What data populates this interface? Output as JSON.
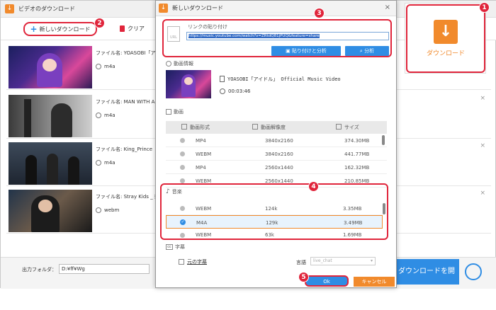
{
  "main": {
    "title": "ビデオのダウンロード",
    "new_download": "新しいダウンロード",
    "clear": "クリア",
    "items": [
      {
        "name": "ファイル名: YOASOBI「アイドル」",
        "format": "m4a"
      },
      {
        "name": "ファイル名: MAN WITH A M",
        "format": "m4a"
      },
      {
        "name": "ファイル名: King_Prince「なに",
        "format": "m4a"
      },
      {
        "name": "ファイル名: Stray Kids _ 樂(S",
        "format": "webm"
      }
    ],
    "output_label": "出力フォルダ：",
    "output_path": "D:¥ff¥Wg",
    "download_start": "ダウンロードを開始",
    "big_download": "ダウンロード"
  },
  "dialog": {
    "title": "新しいダウンロード",
    "close": "×",
    "paste_label": "リンクの貼り付け",
    "url": "https://music.youtube.com/watch?v=ZRtdQ81jPUQ&feature=share",
    "paste_analyze": "貼り付けと分析",
    "analyze": "分析",
    "video_info": "動画情報",
    "video_title": "YOASOBI「アイドル」 Official Music Video",
    "duration": "00:03:46",
    "video_section": "動画",
    "col_format": "動画形式",
    "col_resolution": "動画解像度",
    "col_size": "サイズ",
    "video_rows": [
      {
        "format": "MP4",
        "res": "3840x2160",
        "size": "374.30MB"
      },
      {
        "format": "WEBM",
        "res": "3840x2160",
        "size": "441.77MB"
      },
      {
        "format": "MP4",
        "res": "2560x1440",
        "size": "162.32MB"
      },
      {
        "format": "WEBM",
        "res": "2560x1440",
        "size": "210.85MB"
      }
    ],
    "audio_section": "音楽",
    "audio_rows": [
      {
        "format": "WEBM",
        "res": "124k",
        "size": "3.35MB",
        "selected": false
      },
      {
        "format": "M4A",
        "res": "129k",
        "size": "3.49MB",
        "selected": true
      },
      {
        "format": "WEBM",
        "res": "63k",
        "size": "1.69MB",
        "selected": false
      }
    ],
    "subtitle_section": "字幕",
    "original_subs": "元の字幕",
    "language_label": "言語",
    "language_value": "live_chat",
    "ok": "Ok",
    "cancel": "キャンセル"
  },
  "badges": [
    "1",
    "2",
    "3",
    "4",
    "5"
  ],
  "colors": {
    "accent": "#f18a2c",
    "highlight": "#e0253b",
    "blue": "#2f8de4",
    "selected_row": "#e8f3fd"
  }
}
